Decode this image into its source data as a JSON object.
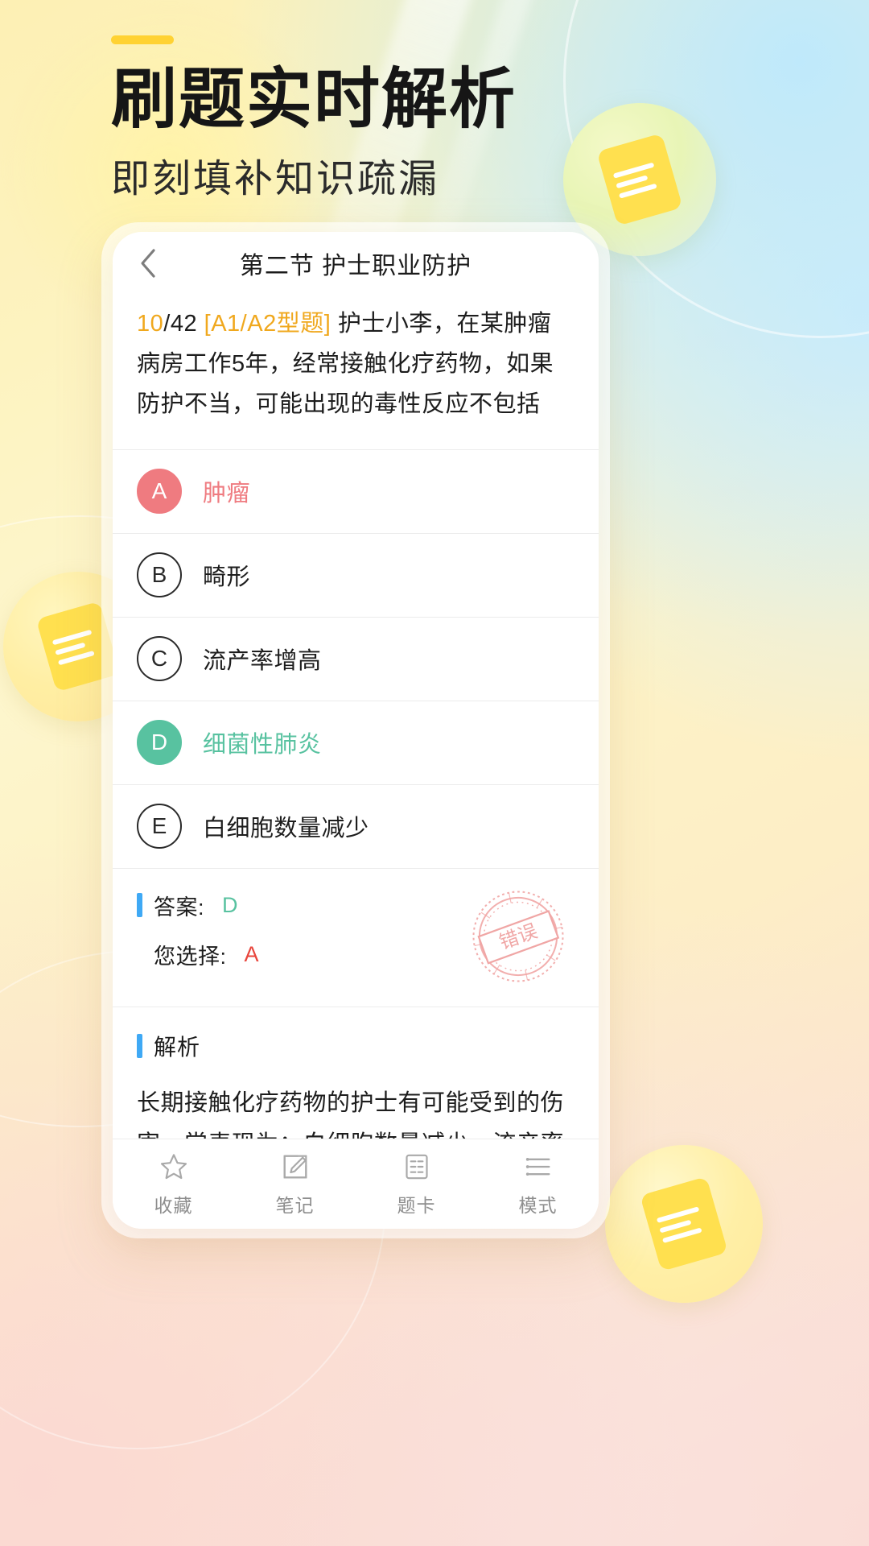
{
  "hero": {
    "title": "刷题实时解析",
    "subtitle": "即刻填补知识疏漏",
    "accent_color": "#ffd233"
  },
  "app": {
    "header": {
      "back_icon": "chevron-left-icon",
      "title": "第二节 护士职业防护"
    },
    "question": {
      "index": "10",
      "total": "/42",
      "type_tag": "[A1/A2型题]",
      "stem": "护士小李，在某肿瘤病房工作5年，经常接触化疗药物，如果防护不当，可能出现的毒性反应不包括"
    },
    "options": [
      {
        "key": "A",
        "text": "肿瘤",
        "state": "wrong"
      },
      {
        "key": "B",
        "text": "畸形",
        "state": "normal"
      },
      {
        "key": "C",
        "text": "流产率增高",
        "state": "normal"
      },
      {
        "key": "D",
        "text": "细菌性肺炎",
        "state": "correct"
      },
      {
        "key": "E",
        "text": "白细胞数量减少",
        "state": "normal"
      }
    ],
    "answer": {
      "answer_label": "答案:",
      "answer_value": "D",
      "chosen_label": "您选择:",
      "chosen_value": "A",
      "stamp_text": "错误"
    },
    "explanation": {
      "title": "解析",
      "text": "长期接触化疗药物的护士有可能受到的伤害，常表现为：白细胞数量减少、流产率增高，甚至导致胎儿畸形、肿瘤及脏器损伤等。但是不会引起"
    },
    "bottom_nav": [
      {
        "icon": "star-icon",
        "label": "收藏"
      },
      {
        "icon": "note-edit-icon",
        "label": "笔记"
      },
      {
        "icon": "card-list-icon",
        "label": "题卡"
      },
      {
        "icon": "mode-lines-icon",
        "label": "模式"
      }
    ]
  },
  "colors": {
    "correct": "#58c2a0",
    "wrong": "#ef7b80",
    "wrong_text": "#e8453c",
    "accent_orange": "#f0a81e",
    "marker_blue": "#3fa9f5"
  }
}
